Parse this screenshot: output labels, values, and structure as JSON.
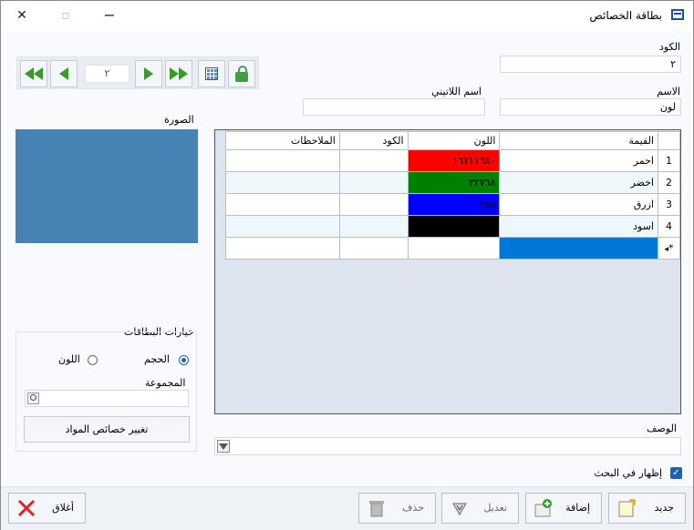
{
  "window": {
    "title": "بطاقة الخصائص",
    "title_icon": "card-icon"
  },
  "toolbar": {
    "record_number": "٢"
  },
  "form": {
    "code_label": "الكود",
    "code_value": "٢",
    "name_label": "الاسم",
    "name_value": "لون",
    "latin_name_label": "اسم اللاتيني",
    "latin_name_value": ""
  },
  "image": {
    "label": "الصورة",
    "color": "#4682b4"
  },
  "card_options": {
    "title": "خيارات البطاقات",
    "size_label": "الحجم",
    "color_label": "اللون",
    "selected": "size",
    "group_label": "المجموعة",
    "group_value": "",
    "change_button": "تغيير خصائص المواد"
  },
  "grid": {
    "columns": [
      "القيمة",
      "اللون",
      "الكود",
      "الملاحظات"
    ],
    "rows": [
      {
        "index": "1",
        "value": "احمر",
        "color_text": "١٦٧١١٦٨٠",
        "color": "#ff0000",
        "code": "",
        "notes": ""
      },
      {
        "index": "2",
        "value": "اخضر",
        "color_text": "٣٢٧٦٨",
        "color": "#008000",
        "code": "",
        "notes": ""
      },
      {
        "index": "3",
        "value": "ازرق",
        "color_text": "٢٥٥",
        "color": "#0000ff",
        "code": "",
        "notes": ""
      },
      {
        "index": "4",
        "value": "اسود",
        "color_text": "",
        "color": "#000000",
        "code": "",
        "notes": ""
      }
    ],
    "new_row_marker": "*",
    "selection_color": "#0078d7"
  },
  "description": {
    "label": "الوصف",
    "value": ""
  },
  "show_in_search": {
    "label": "إظهار في البحث",
    "checked": true
  },
  "buttons": {
    "new": "جديد",
    "add": "إضافة",
    "edit": "تعديل",
    "delete": "حذف",
    "close": "أغلاق"
  }
}
